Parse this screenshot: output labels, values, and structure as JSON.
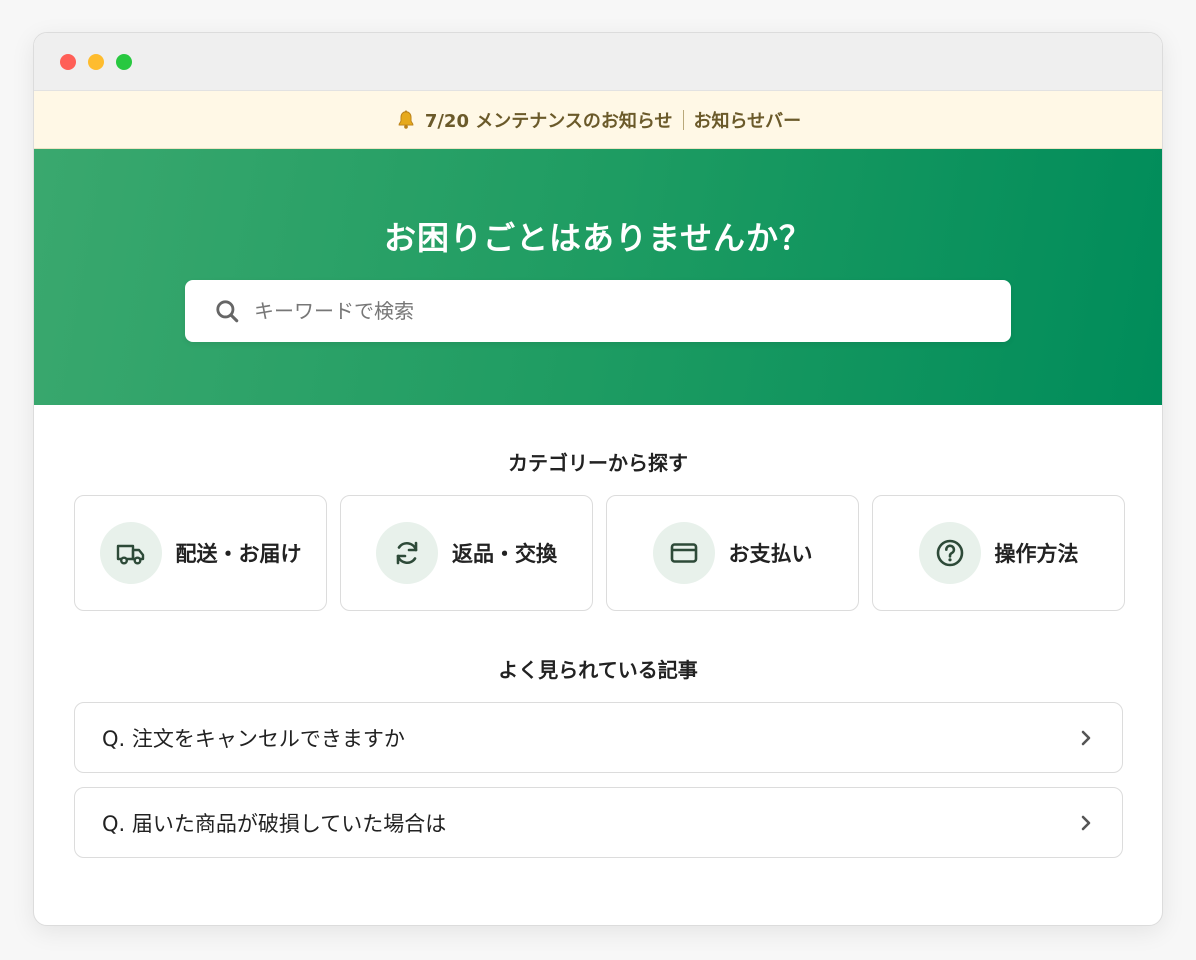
{
  "window": {
    "controls": [
      "close",
      "minimize",
      "maximize"
    ]
  },
  "notice": {
    "icon": "bell-icon",
    "text": "7/20 メンテナンスのお知らせ",
    "bar_label": "お知らせバー"
  },
  "hero": {
    "title": "お困りごとはありませんか？",
    "search": {
      "placeholder": "キーワードで検索",
      "value": "",
      "icon": "search-icon"
    }
  },
  "categories": {
    "title": "カテゴリーから探す",
    "items": [
      {
        "label": "配送・お届け",
        "icon": "truck-icon"
      },
      {
        "label": "返品・交換",
        "icon": "refresh-icon"
      },
      {
        "label": "お支払い",
        "icon": "credit-card-icon"
      },
      {
        "label": "操作方法",
        "icon": "help-icon"
      }
    ]
  },
  "articles": {
    "title": "よく見られている記事",
    "items": [
      {
        "label": "Q. 注文をキャンセルできますか"
      },
      {
        "label": "Q. 届いた商品が破損していた場合は"
      }
    ]
  },
  "colors": {
    "accent": "#1e9c62",
    "icon_dark": "#2d4a38",
    "icon_bg": "#e8f1eb",
    "notice_bg": "#fff8e6"
  }
}
